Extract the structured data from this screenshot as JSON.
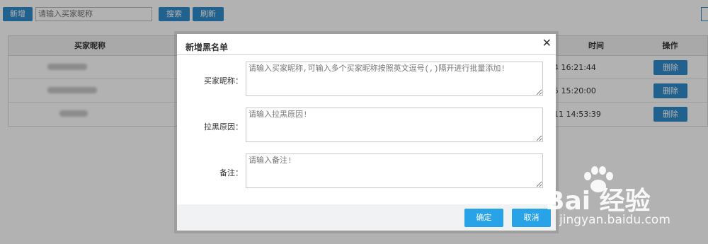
{
  "toolbar": {
    "add_label": "新增",
    "search_placeholder": "请输入买家昵称",
    "search_label": "搜索",
    "refresh_label": "刷新"
  },
  "table": {
    "headers": {
      "name": "买家昵称",
      "time": "时间",
      "op": "操作"
    },
    "rows": [
      {
        "time": "4 16:21:44",
        "delete_label": "删除"
      },
      {
        "time": "5 15:20:00",
        "delete_label": "删除"
      },
      {
        "time": "11 14:53:39",
        "delete_label": "删除"
      }
    ]
  },
  "modal": {
    "title": "新增黑名单",
    "close_glyph": "✕",
    "fields": [
      {
        "label": "买家昵称：",
        "placeholder": "请输入买家昵称,可输入多个买家昵称按照英文逗号(,)隔开进行批量添加!"
      },
      {
        "label": "拉黑原因：",
        "placeholder": "请输入拉黑原因!"
      },
      {
        "label": "备注：",
        "placeholder": "请输入备注!"
      }
    ],
    "confirm_label": "确定",
    "cancel_label": "取消"
  },
  "watermark": {
    "brand": "Bai 经验",
    "url": "jingyan.baidu.com",
    "icon": "baidu-paw-icon"
  },
  "colors": {
    "accent": "#2e8bcc",
    "modal_button": "#29a3e8"
  }
}
